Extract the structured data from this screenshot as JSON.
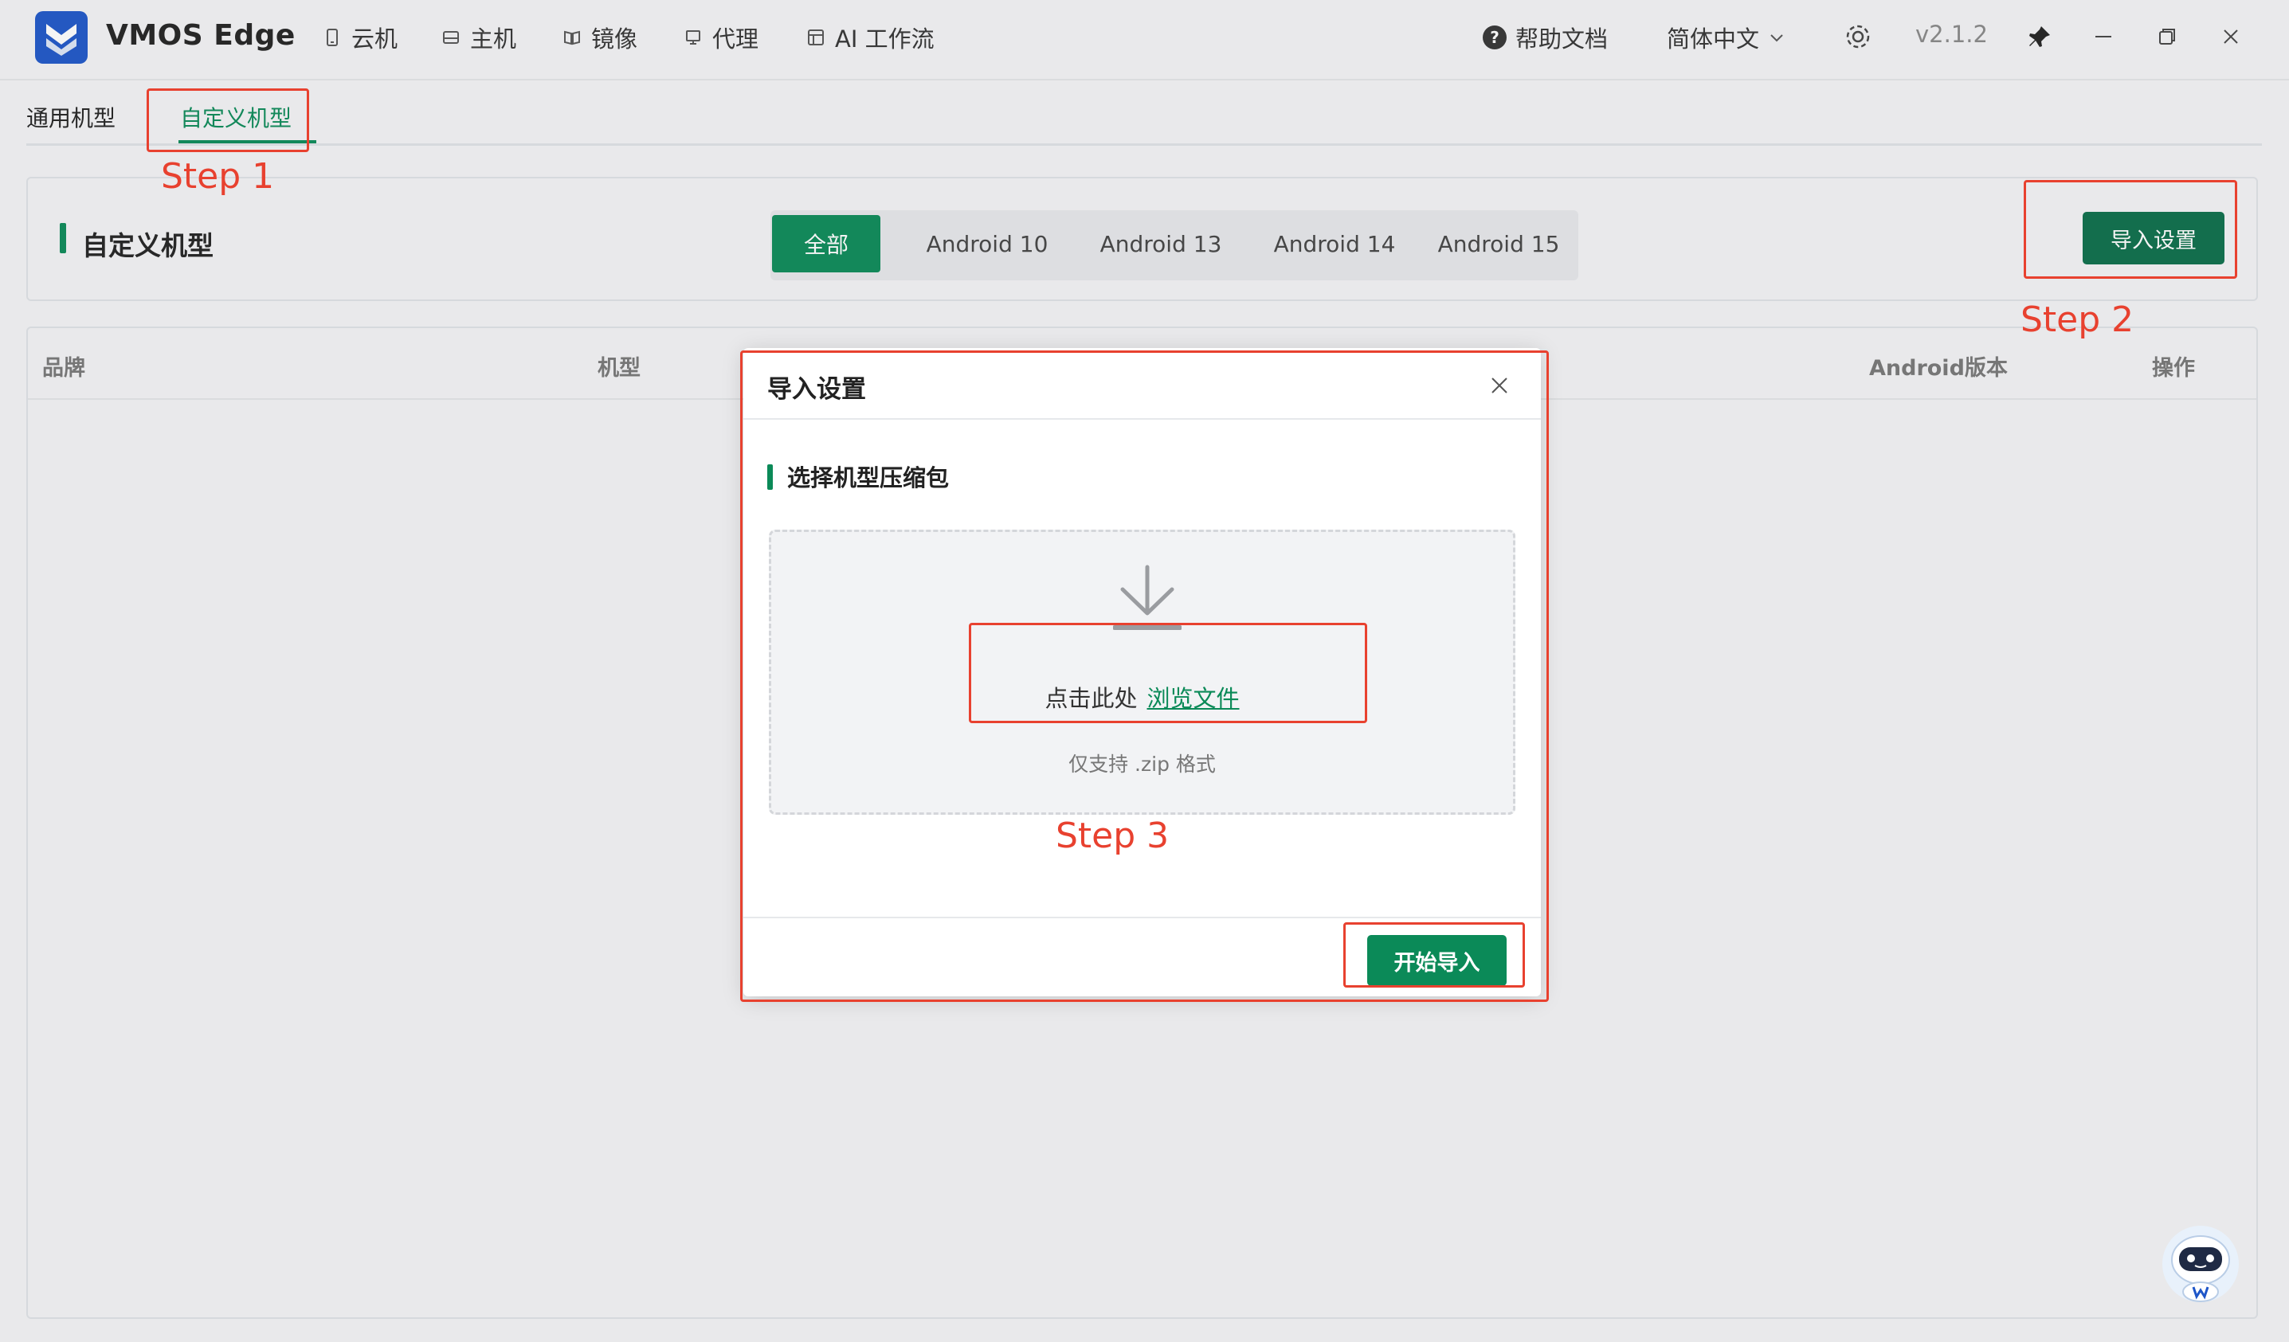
{
  "app": {
    "title": "VMOS Edge",
    "brand_color": "#1e56c8",
    "accent_color": "#0b8a58"
  },
  "nav": {
    "items": [
      {
        "label": "云机",
        "icon": "phone-icon"
      },
      {
        "label": "主机",
        "icon": "server-icon"
      },
      {
        "label": "镜像",
        "icon": "image-icon"
      },
      {
        "label": "代理",
        "icon": "proxy-icon"
      },
      {
        "label": "AI 工作流",
        "icon": "workflow-icon"
      }
    ]
  },
  "titlebar_right": {
    "help": "帮助文档",
    "language": "简体中文",
    "version": "v2.1.2"
  },
  "tabs": [
    {
      "label": "通用机型",
      "active": false
    },
    {
      "label": "自定义机型",
      "active": true
    }
  ],
  "header": {
    "title": "自定义机型",
    "filters": [
      {
        "label": "全部",
        "active": true
      },
      {
        "label": "Android 10",
        "active": false
      },
      {
        "label": "Android 13",
        "active": false
      },
      {
        "label": "Android 14",
        "active": false
      },
      {
        "label": "Android 15",
        "active": false
      }
    ],
    "import_button": "导入设置"
  },
  "table": {
    "columns": [
      "品牌",
      "机型",
      "Android版本",
      "操作"
    ]
  },
  "dialog": {
    "title": "导入设置",
    "section_title": "选择机型压缩包",
    "drop_prefix": "点击此处",
    "drop_link": "浏览文件",
    "drop_hint": "仅支持 .zip 格式",
    "start_button": "开始导入"
  },
  "annotations": {
    "step1": "Step 1",
    "step2": "Step 2",
    "step3": "Step 3",
    "color": "#e8412f"
  }
}
